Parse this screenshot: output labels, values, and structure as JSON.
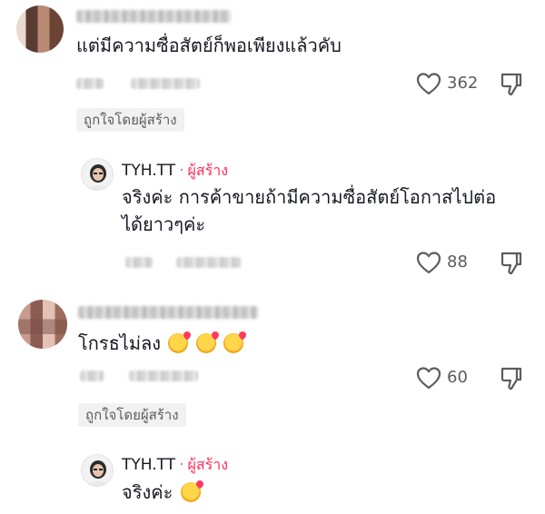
{
  "comments": [
    {
      "text": "แต่มีความซื่อสัตย์ก็พอเพียงแล้วคับ",
      "likes": "362",
      "liked_by_creator": "ถูกใจโดยผู้สร้าง",
      "reply": {
        "username": "TYH.TT",
        "separator": "·",
        "badge": "ผู้สร้าง",
        "lines": [
          "จริงค่ะ การค้าขายถ้ามีความซื่อสัตย์โอกาสไปต่อ",
          "ได้ยาวๆค่ะ"
        ],
        "likes": "88"
      }
    },
    {
      "text": "โกรธไม่ลง",
      "emoji_count": 3,
      "likes": "60",
      "liked_by_creator": "ถูกใจโดยผู้สร้าง",
      "reply": {
        "username": "TYH.TT",
        "separator": "·",
        "badge": "ผู้สร้าง",
        "lines": [
          "จริงค่ะ"
        ],
        "emoji_count": 1
      }
    }
  ],
  "icons": {
    "like": "heart-outline-icon",
    "dislike": "thumbs-down-icon"
  },
  "colors": {
    "creator_badge": "#fe2c55",
    "meta_text": "#5c5c5c",
    "pill_bg": "#f1f1f2"
  }
}
